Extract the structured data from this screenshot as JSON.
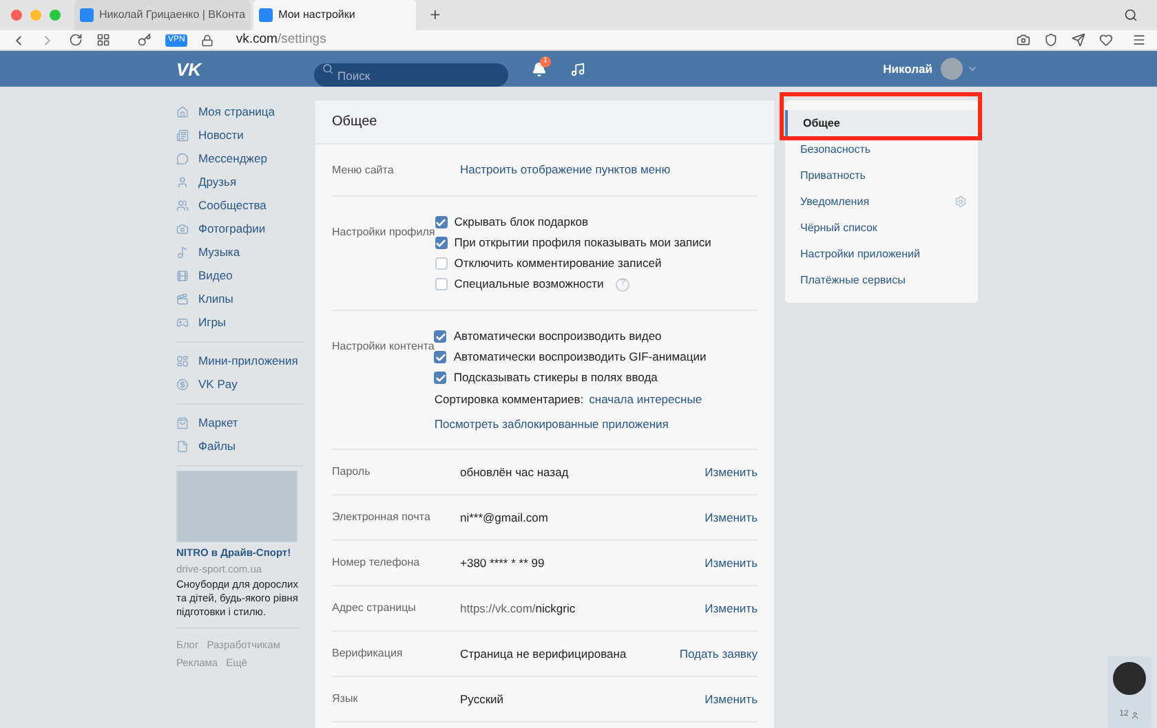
{
  "browser": {
    "tabs": [
      {
        "title": "Николай Грицаенко | ВКонта",
        "selected": false
      },
      {
        "title": "Мои настройки",
        "selected": true
      }
    ],
    "new_tab": "+",
    "vpn": "VPN",
    "url": {
      "host": "vk.com",
      "path": "/settings"
    }
  },
  "header": {
    "logo": "VK",
    "search": {
      "placeholder": "Поиск"
    },
    "notification_count": "1",
    "user_name": "Николай"
  },
  "left_nav": {
    "groups": [
      [
        "Моя страница",
        "Новости",
        "Мессенджер",
        "Друзья",
        "Сообщества",
        "Фотографии",
        "Музыка",
        "Видео",
        "Клипы",
        "Игры"
      ],
      [
        "Мини-приложения",
        "VK Pay"
      ],
      [
        "Маркет",
        "Файлы"
      ]
    ]
  },
  "ad": {
    "title": "NITRO в Драйв-Спорт!",
    "domain": "drive-sport.com.ua",
    "text": "Сноуборди для дорослих та дітей, будь-якого рівня підготовки і стилю."
  },
  "footer_links": [
    "Блог",
    "Разработчикам",
    "Реклама",
    "Ещё"
  ],
  "settings": {
    "title": "Общее",
    "rows": [
      {
        "kind": "link",
        "label": "Меню сайта",
        "link": "Настроить отображение пунктов меню"
      },
      {
        "kind": "checkboxes",
        "label": "Настройки профиля",
        "options": [
          {
            "text": "Скрывать блок подарков",
            "checked": true
          },
          {
            "text": "При открытии профиля показывать мои записи",
            "checked": true
          },
          {
            "text": "Отключить комментирование записей",
            "checked": false
          },
          {
            "text": "Специальные возможности",
            "checked": false,
            "help": "?"
          }
        ]
      },
      {
        "kind": "checkboxes",
        "label": "Настройки контента",
        "options": [
          {
            "text": "Автоматически воспроизводить видео",
            "checked": true
          },
          {
            "text": "Автоматически воспроизводить GIF-анимации",
            "checked": true
          },
          {
            "text": "Подсказывать стикеры в полях ввода",
            "checked": true
          }
        ],
        "sort_label": "Сортировка комментариев:",
        "sort_value": "сначала интересные",
        "link": "Посмотреть заблокированные приложения"
      },
      {
        "kind": "value",
        "label": "Пароль",
        "value": "обновлён час назад",
        "action": "Изменить"
      },
      {
        "kind": "value",
        "label": "Электронная почта",
        "value": "ni***@gmail.com",
        "action": "Изменить"
      },
      {
        "kind": "value",
        "label": "Номер телефона",
        "value": "+380 **** * ** 99",
        "action": "Изменить"
      },
      {
        "kind": "address",
        "label": "Адрес страницы",
        "prefix": "https://vk.com/",
        "value": "nickgric",
        "action": "Изменить"
      },
      {
        "kind": "value",
        "label": "Верификация",
        "value": "Страница не верифицирована",
        "action": "Подать заявку"
      },
      {
        "kind": "value",
        "label": "Язык",
        "value": "Русский",
        "action": "Изменить"
      }
    ]
  },
  "settings_menu": [
    {
      "label": "Общее",
      "selected": true,
      "gear": false
    },
    {
      "label": "Безопасность",
      "selected": false,
      "gear": false
    },
    {
      "label": "Приватность",
      "selected": false,
      "gear": false
    },
    {
      "label": "Уведомления",
      "selected": false,
      "gear": true
    },
    {
      "label": "Чёрный список",
      "selected": false,
      "gear": false
    },
    {
      "label": "Настройки приложений",
      "selected": false,
      "gear": false
    },
    {
      "label": "Платёжные сервисы",
      "selected": false,
      "gear": false
    }
  ],
  "chat": {
    "count": "12"
  }
}
